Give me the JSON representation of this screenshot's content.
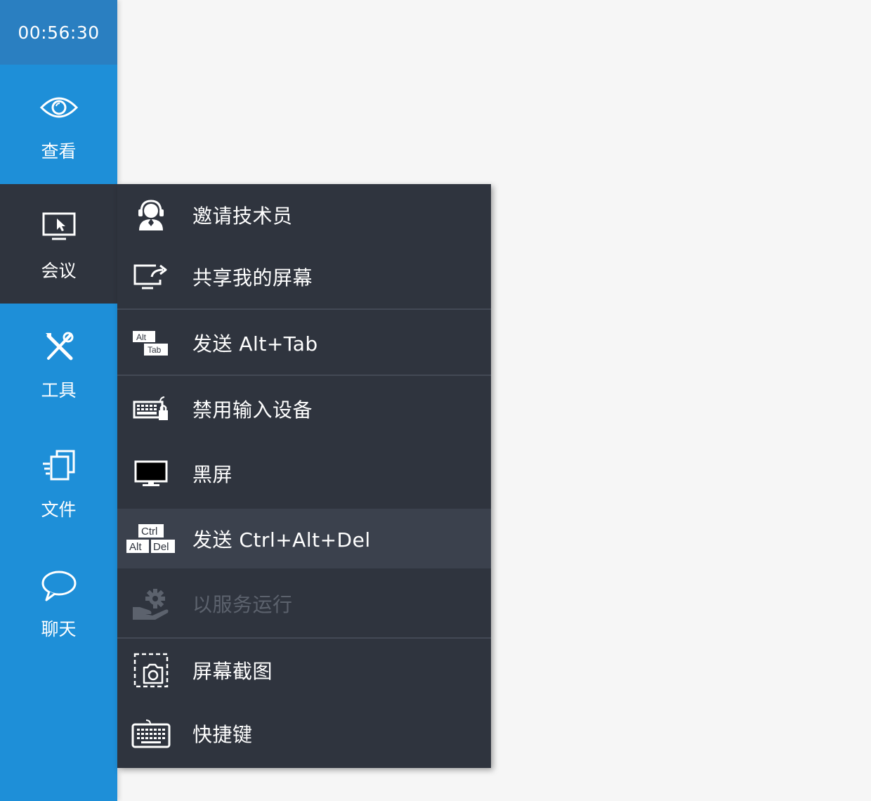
{
  "sidebar": {
    "timer": "00:56:30",
    "items": [
      {
        "label": "查看",
        "icon": "eye-icon"
      },
      {
        "label": "会议",
        "icon": "monitor-cursor-icon"
      },
      {
        "label": "工具",
        "icon": "tools-icon"
      },
      {
        "label": "文件",
        "icon": "files-icon"
      },
      {
        "label": "聊天",
        "icon": "chat-bubble-icon"
      }
    ],
    "active_item": "会议"
  },
  "menu": {
    "items": [
      {
        "label": "邀请技术员",
        "icon": "technician-headset-icon"
      },
      {
        "label": "共享我的屏幕",
        "icon": "share-screen-icon"
      },
      {
        "label": "发送 Alt+Tab",
        "icon": "alt-tab-keys-icon",
        "icon_keys": [
          "Alt",
          "Tab"
        ]
      },
      {
        "label": "禁用输入设备",
        "icon": "keyboard-lock-icon"
      },
      {
        "label": "黑屏",
        "icon": "black-screen-monitor-icon"
      },
      {
        "label": "发送 Ctrl+Alt+Del",
        "icon": "ctrl-alt-del-keys-icon",
        "icon_keys": [
          "Ctrl",
          "Alt",
          "Del"
        ],
        "highlighted": true
      },
      {
        "label": "以服务运行",
        "icon": "service-gear-hand-icon",
        "disabled": true
      },
      {
        "label": "屏幕截图",
        "icon": "screenshot-camera-icon"
      },
      {
        "label": "快捷键",
        "icon": "keyboard-icon"
      }
    ]
  },
  "colors": {
    "sidebar_bg": "#1e8fd8",
    "timer_bg": "#2a7fc1",
    "menu_bg": "#2f343e",
    "menu_highlight": "#3b414d",
    "disabled_text": "#5c626d",
    "page_bg": "#f6f6f6"
  }
}
